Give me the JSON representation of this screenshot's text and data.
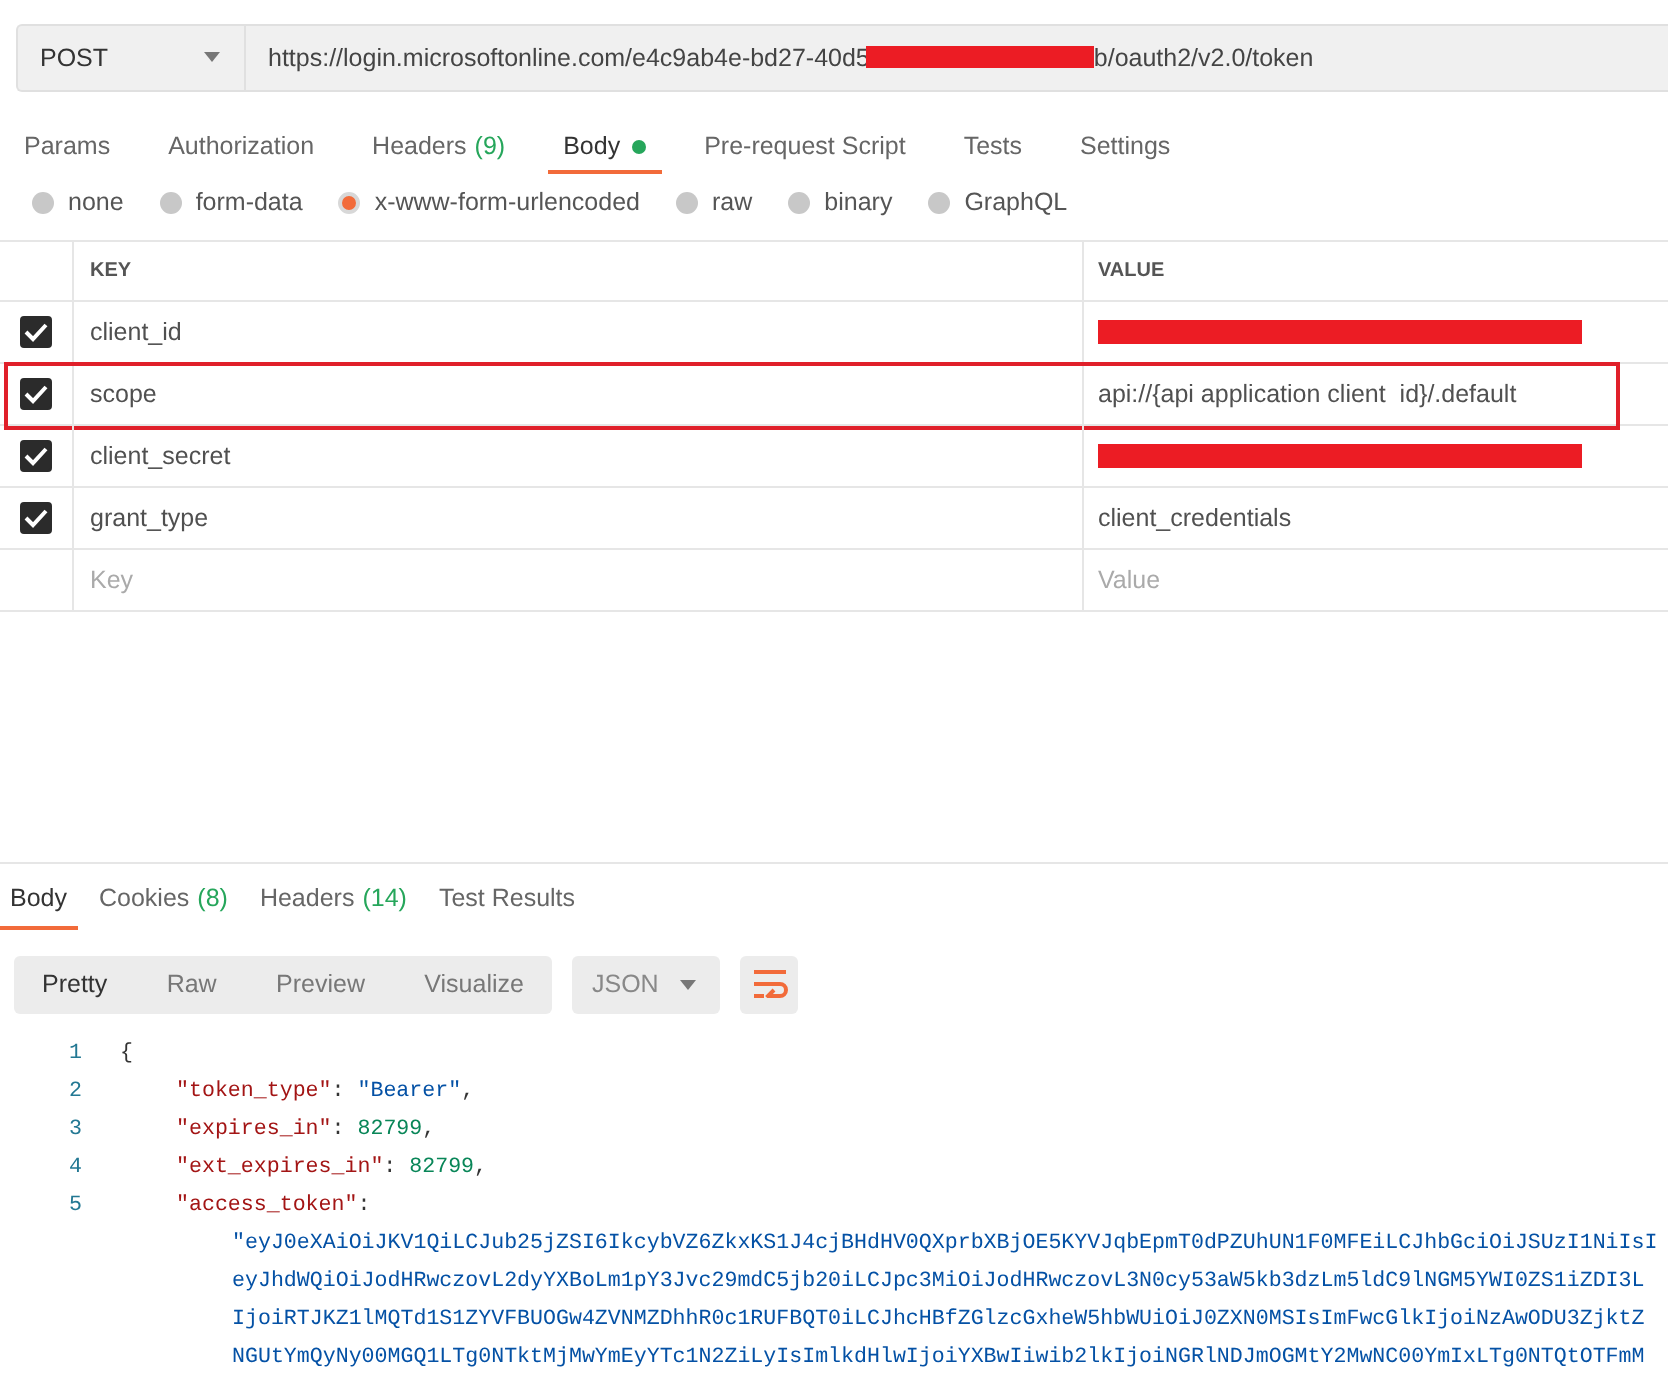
{
  "request_bar": {
    "method": "POST",
    "url_start": "https://login.microsoftonline.com/e4c9ab4e-bd27-40d5",
    "url_redacted": true,
    "url_end": "b/oauth2/v2.0/token"
  },
  "request_tabs": [
    {
      "label": "Params",
      "selected": false
    },
    {
      "label": "Authorization",
      "selected": false
    },
    {
      "label": "Headers",
      "count": "(9)",
      "selected": false
    },
    {
      "label": "Body",
      "dot": true,
      "selected": true
    },
    {
      "label": "Pre-request Script",
      "selected": false
    },
    {
      "label": "Tests",
      "selected": false
    },
    {
      "label": "Settings",
      "selected": false
    }
  ],
  "body_types": [
    {
      "label": "none",
      "selected": false
    },
    {
      "label": "form-data",
      "selected": false
    },
    {
      "label": "x-www-form-urlencoded",
      "selected": true
    },
    {
      "label": "raw",
      "selected": false
    },
    {
      "label": "binary",
      "selected": false
    },
    {
      "label": "GraphQL",
      "selected": false
    }
  ],
  "params_table": {
    "columns": [
      "KEY",
      "VALUE"
    ],
    "rows": [
      {
        "checked": true,
        "key": "client_id",
        "kind": "redacted",
        "highlighted": false
      },
      {
        "checked": true,
        "key": "scope",
        "kind": "text",
        "value": "api://{api application client  id}/.default",
        "highlighted": true
      },
      {
        "checked": true,
        "key": "client_secret",
        "kind": "redacted",
        "highlighted": false
      },
      {
        "checked": true,
        "key": "grant_type",
        "kind": "text",
        "value": "client_credentials",
        "highlighted": false
      }
    ],
    "new_row": {
      "key_placeholder": "Key",
      "value_placeholder": "Value"
    }
  },
  "response_tabs": [
    {
      "label": "Body",
      "selected": true
    },
    {
      "label": "Cookies",
      "count": "(8)",
      "selected": false
    },
    {
      "label": "Headers",
      "count": "(14)",
      "selected": false
    },
    {
      "label": "Test Results",
      "selected": false
    }
  ],
  "view_modes": [
    {
      "label": "Pretty",
      "selected": true
    },
    {
      "label": "Raw",
      "selected": false
    },
    {
      "label": "Preview",
      "selected": false
    },
    {
      "label": "Visualize",
      "selected": false
    }
  ],
  "format": "JSON",
  "code_lines": [
    {
      "kind": "open",
      "number": "1",
      "parts": [
        {
          "kind": "punct",
          "text": "{"
        }
      ]
    },
    {
      "kind": "member",
      "number": "2",
      "parts": [
        {
          "kind": "key",
          "text": "\"token_type\""
        },
        {
          "kind": "punct",
          "text": ": "
        },
        {
          "kind": "string",
          "text": "\"Bearer\""
        },
        {
          "kind": "punct",
          "text": ","
        }
      ]
    },
    {
      "kind": "member",
      "number": "3",
      "parts": [
        {
          "kind": "key",
          "text": "\"expires_in\""
        },
        {
          "kind": "punct",
          "text": ": "
        },
        {
          "kind": "number",
          "text": "82799"
        },
        {
          "kind": "punct",
          "text": ","
        }
      ]
    },
    {
      "kind": "member",
      "number": "4",
      "parts": [
        {
          "kind": "key",
          "text": "\"ext_expires_in\""
        },
        {
          "kind": "punct",
          "text": ": "
        },
        {
          "kind": "number",
          "text": "82799"
        },
        {
          "kind": "punct",
          "text": ","
        }
      ]
    },
    {
      "kind": "member",
      "number": "5",
      "parts": [
        {
          "kind": "key",
          "text": "\"access_token\""
        },
        {
          "kind": "punct",
          "text": ":"
        }
      ]
    },
    {
      "kind": "wrap_first",
      "parts": [
        {
          "kind": "string",
          "text": "\"eyJ0eXAiOiJKV1QiLCJub25jZSI6IkcybVZ6ZkxKS1J4cjBHdHV0QXprbXBjOE5KYVJqbEpmT0dPZUhUN1F0MFEiLCJhbGciOiJSUzI1NiIsI"
        }
      ]
    },
    {
      "kind": "wrap",
      "parts": [
        {
          "kind": "string",
          "text": "eyJhdWQiOiJodHRwczovL2dyYXBoLm1pY3Jvc29mdC5jb20iLCJpc3MiOiJodHRwczovL3N0cy53aW5kb3dzLm5ldC9lNGM5YWI0ZS1iZDI3L"
        }
      ]
    },
    {
      "kind": "wrap",
      "parts": [
        {
          "kind": "string",
          "text": "IjoiRTJKZ1lMQTd1S1ZYVFBUOGw4ZVNMZDhhR0c1RUFBQT0iLCJhcHBfZGlzcGxheW5hbWUiOiJ0ZXN0MSIsImFwcGlkIjoiNzAwODU3ZjktZ"
        }
      ]
    },
    {
      "kind": "wrap",
      "parts": [
        {
          "kind": "string",
          "text": "NGUtYmQyNy00MGQ1LTg0NTktMjMwYmEyYTc1N2ZiLyIsImlkdHlwIjoiYXBwIiwib2lkIjoiNGRlNDJmOGMtY2MwNC00YmIxLTg0NTQtOTFmM"
        }
      ]
    }
  ]
}
